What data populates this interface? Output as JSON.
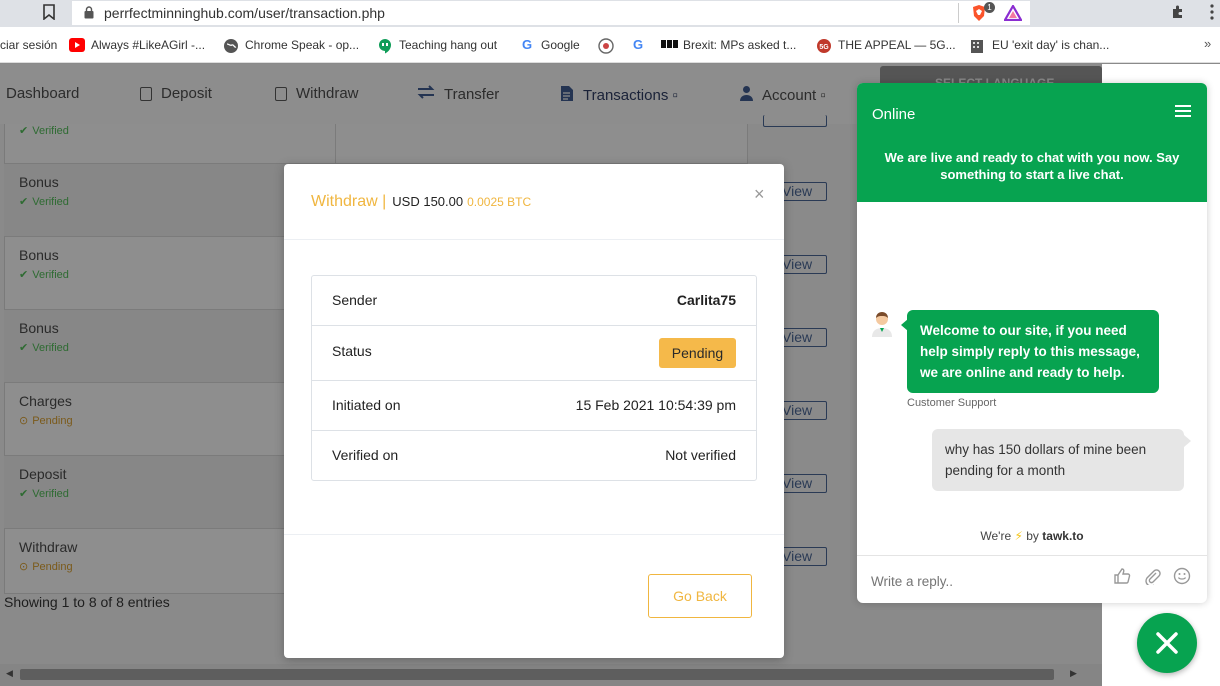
{
  "browser": {
    "url": "perrfectminninghub.com/user/transaction.php",
    "extension_badge": "1",
    "bookmarks": [
      {
        "label": "ciar sesión",
        "icon": "none"
      },
      {
        "label": "Always #LikeAGirl -...",
        "icon": "youtube-icon",
        "color": "#ff0000"
      },
      {
        "label": "Chrome Speak - op...",
        "icon": "globe-icon",
        "color": "#555555"
      },
      {
        "label": "Teaching hang out",
        "icon": "hangouts-icon",
        "color": "#0f9d58"
      },
      {
        "label": "Google",
        "icon": "google-icon",
        "color": "#4285f4"
      },
      {
        "label": "",
        "icon": "site-icon",
        "color": "#888888"
      },
      {
        "label": "",
        "icon": "google-icon",
        "color": "#4285f4"
      },
      {
        "label": "Brexit: MPs asked t...",
        "icon": "bbc-icon",
        "color": "#111111"
      },
      {
        "label": "THE APPEAL — 5G...",
        "icon": "5g-icon",
        "color": "#c0392b"
      },
      {
        "label": "EU 'exit day' is chan...",
        "icon": "building-icon",
        "color": "#555555"
      }
    ],
    "more": "»"
  },
  "nav": {
    "items": [
      {
        "label": "Dashboard"
      },
      {
        "label": "Deposit"
      },
      {
        "label": "Withdraw"
      },
      {
        "label": "Transfer"
      },
      {
        "label": "Transactions ▫"
      },
      {
        "label": "Account ▫"
      }
    ]
  },
  "table": {
    "rows": [
      {
        "type": "",
        "status": "Verified",
        "status_kind": "ok",
        "view": "View"
      },
      {
        "type": "Bonus",
        "status": "Verified",
        "status_kind": "ok",
        "view": "View"
      },
      {
        "type": "Bonus",
        "status": "Verified",
        "status_kind": "ok",
        "view": "View"
      },
      {
        "type": "Bonus",
        "status": "Verified",
        "status_kind": "ok",
        "view": "View"
      },
      {
        "type": "Charges",
        "status": "Pending",
        "status_kind": "pending",
        "view": "View"
      },
      {
        "type": "Deposit",
        "status": "Verified",
        "status_kind": "ok",
        "view": "View"
      },
      {
        "type": "Withdraw",
        "status": "Pending",
        "status_kind": "pending",
        "view": "View"
      }
    ],
    "showing": "Showing 1 to 8 of 8 entries"
  },
  "modal": {
    "title_type": "Withdraw |",
    "amount_usd": "USD 150.00",
    "amount_btc": "0.0025 BTC",
    "close": "×",
    "sender_label": "Sender",
    "sender_value": "Carlita75",
    "status_label": "Status",
    "status_value": "Pending",
    "initiated_label": "Initiated on",
    "initiated_value": "15 Feb 2021 10:54:39 pm",
    "verified_label": "Verified on",
    "verified_value": "Not verified",
    "go_back": "Go Back",
    "colors": {
      "accent": "#f0b640",
      "badge": "#f5b94a"
    }
  },
  "chat": {
    "status": "Online",
    "intro": "We are live and ready to chat with you now. Say something to start a live chat.",
    "agent_message": "Welcome to our site, if you need help simply reply to this message, we are online and ready to help.",
    "agent_name": "Customer Support",
    "user_message": "why has 150 dollars of mine been pending for a month",
    "powered_prefix": "We're",
    "powered_by": "by",
    "powered_brand": "tawk.to",
    "reply_placeholder": "Write a reply..",
    "colors": {
      "brand": "#07a350"
    }
  }
}
